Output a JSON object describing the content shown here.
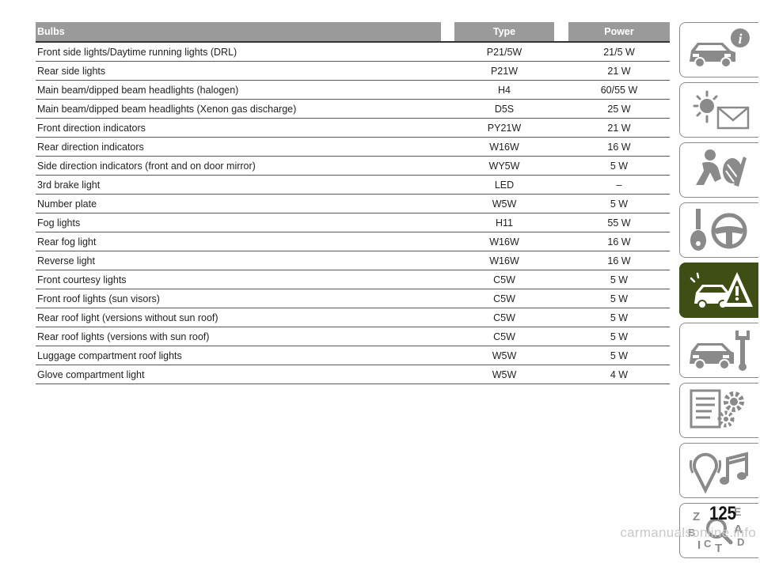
{
  "table": {
    "headers": {
      "bulbs": "Bulbs",
      "type": "Type",
      "power": "Power"
    },
    "rows": [
      {
        "bulb": "Front side lights/Daytime running lights (DRL)",
        "type": "P21/5W",
        "power": "21/5 W"
      },
      {
        "bulb": "Rear side lights",
        "type": "P21W",
        "power": "21 W"
      },
      {
        "bulb": "Main beam/dipped beam headlights (halogen)",
        "type": "H4",
        "power": "60/55 W"
      },
      {
        "bulb": "Main beam/dipped beam headlights (Xenon gas discharge)",
        "type": "D5S",
        "power": "25 W"
      },
      {
        "bulb": "Front direction indicators",
        "type": "PY21W",
        "power": "21 W"
      },
      {
        "bulb": "Rear direction indicators",
        "type": "W16W",
        "power": "16 W"
      },
      {
        "bulb": "Side direction indicators (front and on door mirror)",
        "type": "WY5W",
        "power": "5 W"
      },
      {
        "bulb": "3rd brake light",
        "type": "LED",
        "power": "–"
      },
      {
        "bulb": "Number plate",
        "type": "W5W",
        "power": "5 W"
      },
      {
        "bulb": "Fog lights",
        "type": "H11",
        "power": "55 W"
      },
      {
        "bulb": "Rear fog light",
        "type": "W16W",
        "power": "16 W"
      },
      {
        "bulb": "Reverse light",
        "type": "W16W",
        "power": "16 W"
      },
      {
        "bulb": "Front courtesy lights",
        "type": "C5W",
        "power": "5 W"
      },
      {
        "bulb": "Front roof lights (sun visors)",
        "type": "C5W",
        "power": "5 W"
      },
      {
        "bulb": "Rear roof light (versions without sun roof)",
        "type": "C5W",
        "power": "5 W"
      },
      {
        "bulb": "Rear roof lights (versions with sun roof)",
        "type": "C5W",
        "power": "5 W"
      },
      {
        "bulb": "Luggage compartment roof lights",
        "type": "W5W",
        "power": "5 W"
      },
      {
        "bulb": "Glove compartment light",
        "type": "W5W",
        "power": "4 W"
      }
    ]
  },
  "nav": {
    "tabs": [
      {
        "icon": "car-info-icon",
        "active": false
      },
      {
        "icon": "warning-lights-message-icon",
        "active": false
      },
      {
        "icon": "airbag-seat-icon",
        "active": false
      },
      {
        "icon": "key-steering-wheel-icon",
        "active": false
      },
      {
        "icon": "car-breakdown-warning-icon",
        "active": true
      },
      {
        "icon": "car-maintenance-wrench-icon",
        "active": false
      },
      {
        "icon": "specifications-gears-icon",
        "active": false
      },
      {
        "icon": "multimedia-music-icon",
        "active": false
      },
      {
        "icon": "alphabetical-index-icon",
        "active": false
      }
    ],
    "index_letters": [
      "Z",
      "E",
      "A",
      "B",
      "C",
      "D",
      "T",
      "I"
    ]
  },
  "colors": {
    "header_bg": "#9a9a9a",
    "active_tab": "#3f4e14",
    "icon_gray": "#8a8a8a"
  },
  "page_number": "125",
  "watermark": "carmanualsonline.info"
}
